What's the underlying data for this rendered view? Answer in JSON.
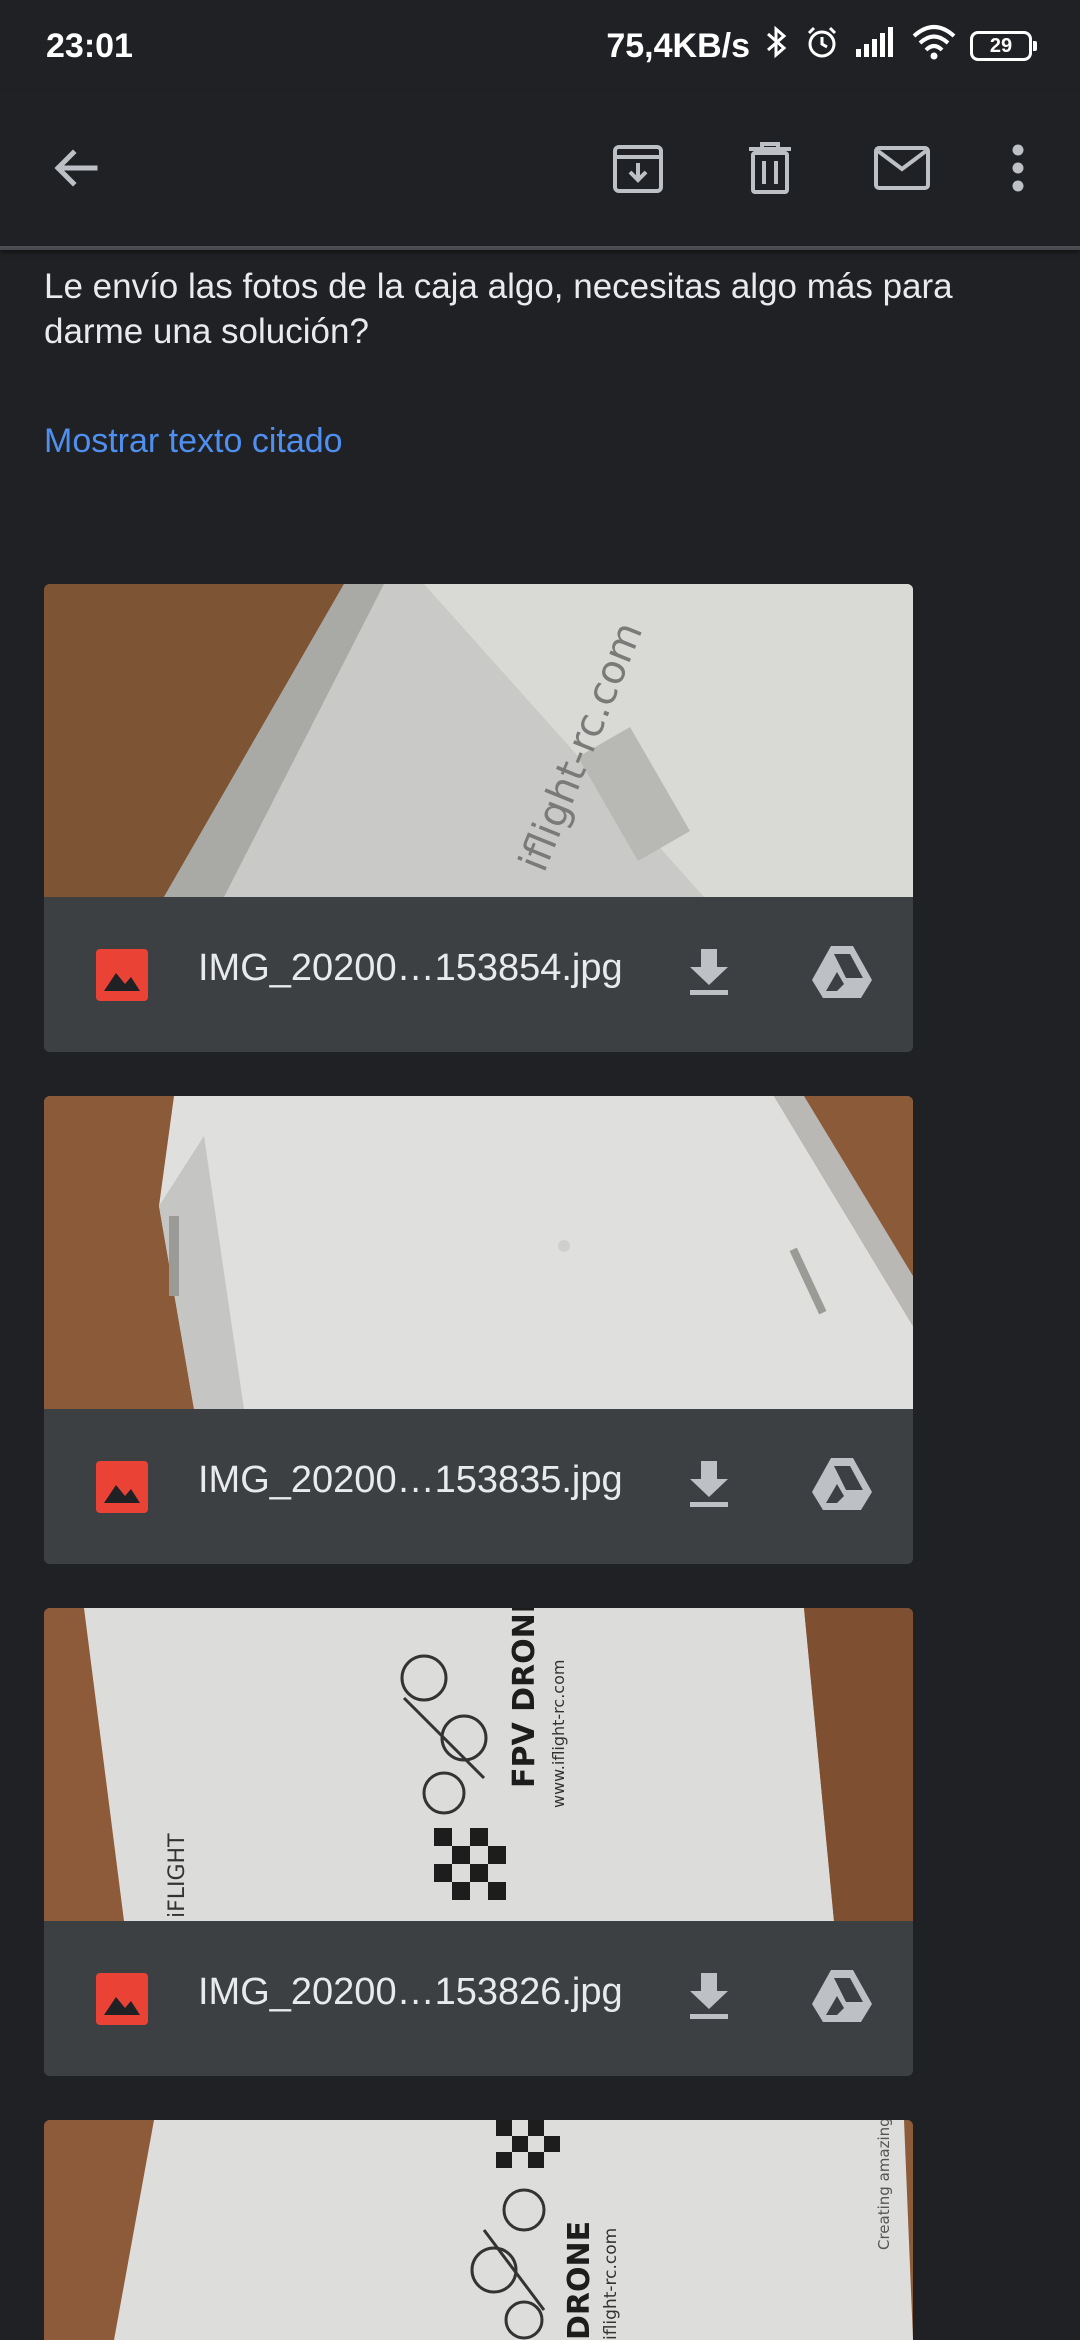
{
  "status_bar": {
    "time": "23:01",
    "net_speed": "75,4KB/s",
    "battery": "29",
    "icons": [
      "bluetooth-icon",
      "alarm-icon",
      "signal-icon",
      "wifi-icon",
      "battery-icon"
    ]
  },
  "toolbar": {
    "icons": [
      "back-arrow-icon",
      "archive-icon",
      "delete-icon",
      "mark-unread-icon",
      "more-vert-icon"
    ]
  },
  "message": {
    "body": "Le envío las fotos de la caja algo, necesitas algo más para darme una solución?",
    "show_quoted": "Mostrar texto citado"
  },
  "attachments": [
    {
      "name": "IMG_20200…153854.jpg"
    },
    {
      "name": "IMG_20200…153835.jpg"
    },
    {
      "name": "IMG_20200…153826.jpg"
    },
    {
      "name": ""
    }
  ],
  "preview_texts": {
    "p1": "iflight-rc.com",
    "p3_a": "FPV DRONE",
    "p3_b": "www.iflight-rc.com",
    "p3_c": "iFLIGHT",
    "p4_a": "DRONE",
    "p4_b": "iflight-rc.com",
    "p4_c": "Creating amazing"
  },
  "colors": {
    "background": "#202124",
    "card": "#3c4043",
    "link": "#4f8fef",
    "image_icon": "#ea4335",
    "icon_grey": "#bdc1c6"
  }
}
